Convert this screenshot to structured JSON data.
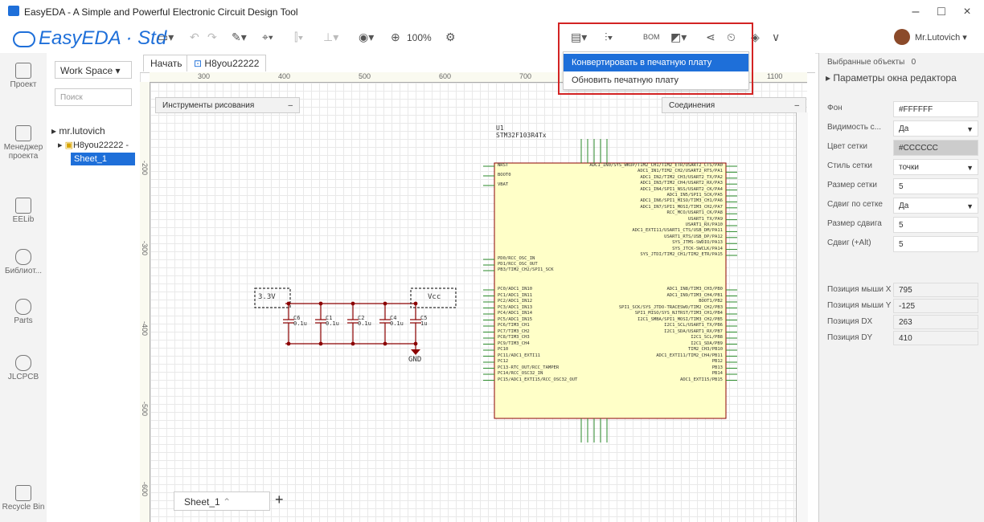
{
  "window": {
    "title": "EasyEDA - A Simple and Powerful Electronic Circuit Design Tool",
    "controls": [
      "–",
      "□",
      "×"
    ]
  },
  "menubar": {
    "logo": "EasyEDA · Std",
    "zoom": "100%",
    "bom": "BOM",
    "user": "Mr.Lutovich"
  },
  "dropdown": {
    "items": [
      "Конвертировать в печатную плату",
      "Обновить печатную плату"
    ],
    "active_index": 0,
    "highlight_color": "#1e6fd9",
    "box_color": "#d32323"
  },
  "leftrail": {
    "items": [
      "Проект",
      "Менеджер проекта",
      "EELib",
      "Библиот...",
      "Parts",
      "JLCPCB",
      "Recycle Bin"
    ]
  },
  "tree": {
    "workspace": "Work Space",
    "search_placeholder": "Поиск",
    "owner": "mr.lutovich",
    "project": "H8you22222 -",
    "sheet": "Sheet_1"
  },
  "tabs": {
    "start": "Начать",
    "doc": "H8you22222"
  },
  "ruler": {
    "top": [
      "300",
      "400",
      "500",
      "600",
      "700",
      "1100"
    ],
    "left": [
      "-200",
      "-300",
      "-400",
      "-500",
      "-600"
    ]
  },
  "panels": {
    "drawing_tools": "Инструменты рисования",
    "connections": "Соединения"
  },
  "schematic": {
    "chip_label": "STM32F103R4Tx",
    "chip_ref": "U1",
    "label_3v3": "3.3V",
    "label_vcc": "Vcc",
    "label_gnd": "GND",
    "caps": [
      {
        "ref": "C6",
        "value": "0.1u"
      },
      {
        "ref": "C1",
        "value": "0.1u"
      },
      {
        "ref": "C2",
        "value": "0.1u"
      },
      {
        "ref": "C4",
        "value": "0.1u"
      },
      {
        "ref": "C5",
        "value": "1u"
      }
    ],
    "left_pins_top": [
      "NRST",
      "BOOT0",
      "VBAT"
    ],
    "left_pins_mid": [
      "PD0/RCC_OSC_IN",
      "PD1/RCC_OSC_OUT",
      "PB3/TIM2_CH2/SPI1_SCK"
    ],
    "left_pins_bot": [
      "PC0/ADC1_IN10",
      "PC1/ADC1_IN11",
      "PC2/ADC1_IN12",
      "PC3/ADC1_IN13",
      "PC4/ADC1_IN14",
      "PC5/ADC1_IN15",
      "PC6/TIM3_CH1",
      "PC7/TIM3_CH2",
      "PC8/TIM3_CH3",
      "PC9/TIM3_CH4",
      "PC10",
      "PC11/ADC1_EXTI11",
      "PC12",
      "PC13-RTC_OUT/RCC_TAMPER",
      "PC14/RCC_OSC32_IN",
      "PC15/ADC1_EXTI15/RCC_OSC32_OUT"
    ],
    "right_pins_top": [
      "ADC1_IN0/SYS_WKUP/TIM2_CH1/TIM2_ETR/USART2_CTS/PA0",
      "ADC1_IN1/TIM2_CH2/USART2_RTS/PA1",
      "ADC1_IN2/TIM2_CH3/USART2_TX/PA2",
      "ADC1_IN3/TIM2_CH4/USART2_RX/PA3",
      "ADC1_IN4/SPI1_NSS/USART2_CK/PA4",
      "ADC1_IN5/SPI1_SCK/PA5",
      "ADC1_IN6/SPI1_MISO/TIM3_CH1/PA6",
      "ADC1_IN7/SPI1_MOSI/TIM3_CH2/PA7",
      "RCC_MCO/USART1_CK/PA8",
      "USART1_TX/PA9",
      "USART1_RX/PA10",
      "ADC1_EXTI11/USART1_CTS/USB_DM/PA11",
      "USART1_RTS/USB_DP/PA12",
      "SYS_JTMS-SWDIO/PA13",
      "SYS_JTCK-SWCLK/PA14",
      "SYS_JTDI/TIM2_CH1/TIM2_ETR/PA15"
    ],
    "right_pins_bot": [
      "ADC1_IN8/TIM3_CH3/PB0",
      "ADC1_IN9/TIM3_CH4/PB1",
      "BOOT1/PB2",
      "SPI1_SCK/SYS_JTDO-TRACESWO/TIM2_CH2/PB3",
      "SPI1_MISO/SYS_NJTRST/TIM3_CH1/PB4",
      "I2C1_SMBA/SPI1_MOSI/TIM3_CH2/PB5",
      "I2C1_SCL/USART1_TX/PB6",
      "I2C1_SDA/USART1_RX/PB7",
      "I2C1_SCL/PB8",
      "I2C1_SDA/PB9",
      "TIM2_CH3/PB10",
      "ADC1_EXTI11/TIM2_CH4/PB11",
      "PB12",
      "PB13",
      "PB14",
      "ADC1_EXTI15/PB15"
    ]
  },
  "rightpanel": {
    "selected_label": "Выбранные объекты",
    "selected_count": "0",
    "section_title": "Параметры окна редактора",
    "rows": [
      {
        "label": "Фон",
        "value": "#FFFFFF",
        "select": false,
        "gray": false
      },
      {
        "label": "Видимость с...",
        "value": "Да",
        "select": true,
        "gray": false
      },
      {
        "label": "Цвет сетки",
        "value": "#CCCCCC",
        "select": false,
        "gray": true
      },
      {
        "label": "Стиль сетки",
        "value": "точки",
        "select": true,
        "gray": false
      },
      {
        "label": "Размер сетки",
        "value": "5",
        "select": false,
        "gray": false
      },
      {
        "label": "Сдвиг по сетке",
        "value": "Да",
        "select": true,
        "gray": false
      },
      {
        "label": "Размер сдвига",
        "value": "5",
        "select": false,
        "gray": false
      },
      {
        "label": "Сдвиг (+Alt)",
        "value": "5",
        "select": false,
        "gray": false
      }
    ],
    "mouse_rows": [
      {
        "label": "Позиция мыши X",
        "value": "795"
      },
      {
        "label": "Позиция мыши Y",
        "value": "-125"
      },
      {
        "label": "Позиция DX",
        "value": "263"
      },
      {
        "label": "Позиция DY",
        "value": "410"
      }
    ]
  },
  "sheettab": {
    "label": "Sheet_1",
    "add": "+"
  }
}
